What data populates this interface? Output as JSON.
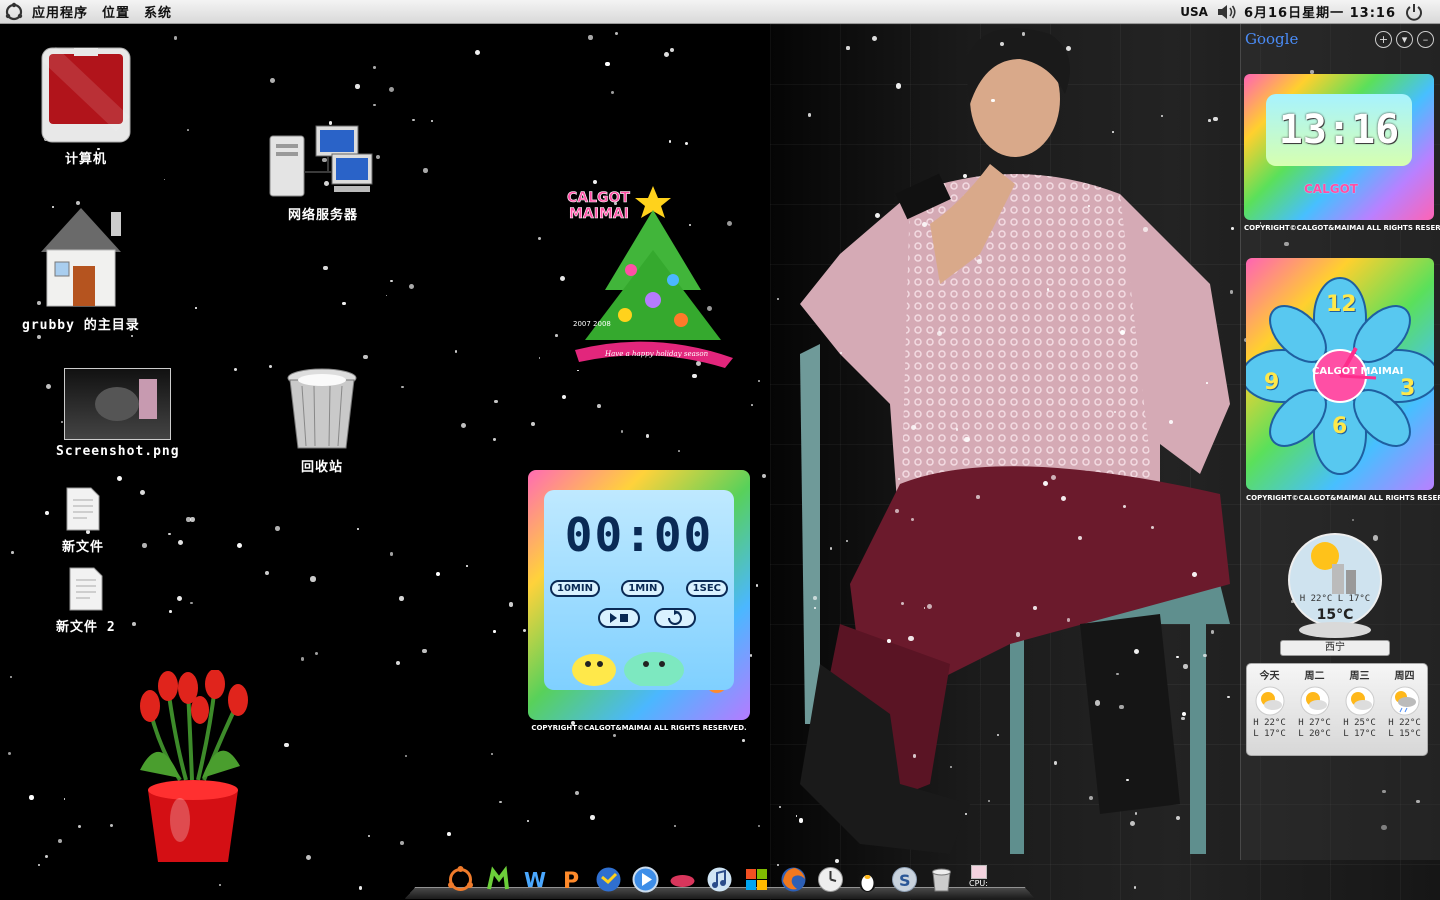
{
  "panel": {
    "menus": [
      "应用程序",
      "位置",
      "系统"
    ],
    "keyboard_layout": "USA",
    "datetime": "6月16日星期一  13:16"
  },
  "desktop_icons": {
    "computer": "计算机",
    "network": "网络服务器",
    "home": "grubby 的主目录",
    "screenshot": "Screenshot.png",
    "trash": "回收站",
    "newfile1": "新文件",
    "newfile2": "新文件 2"
  },
  "timer_widget": {
    "display": "00:00",
    "buttons": [
      "10MIN",
      "1MIN",
      "1SEC"
    ],
    "copyright": "COPYRIGHT©CALGOT&MAIMAI ALL RIGHTS RESERVED."
  },
  "tree_widget": {
    "brand": "CALGOT MAIMAI",
    "banner": "Have a happy holiday season",
    "years": "2007 2008"
  },
  "sidebar": {
    "title": "Google",
    "ctrl_add": "+",
    "ctrl_menu": "▾",
    "ctrl_min": "–",
    "digital_clock": "13:16",
    "clock_copyright": "COPYRIGHT©CALGOT&MAIMAI ALL RIGHTS RESERVED.",
    "analog_numbers": [
      "12",
      "3",
      "6",
      "9"
    ],
    "analog_brand": "CALGOT MAIMAI",
    "analog_copyright": "COPYRIGHT©CALGOT&MAIMAI ALL RIGHTS RESERVED."
  },
  "weather": {
    "hi_lo": "H 22°C  L 17°C",
    "current": "15°C",
    "city": "西宁",
    "forecast": [
      {
        "day": "今天",
        "hi": "H 22°C",
        "lo": "L 17°C"
      },
      {
        "day": "周二",
        "hi": "H 27°C",
        "lo": "L 20°C"
      },
      {
        "day": "周三",
        "hi": "H 25°C",
        "lo": "L 17°C"
      },
      {
        "day": "周四",
        "hi": "H 22°C",
        "lo": "L 15°C"
      }
    ]
  },
  "dock": {
    "cpu_label": "CPU:"
  },
  "colors": {
    "panel_bg": "#e6e6e6",
    "desktop_bg": "#000000",
    "accent_ubuntu": "#dd4814"
  }
}
